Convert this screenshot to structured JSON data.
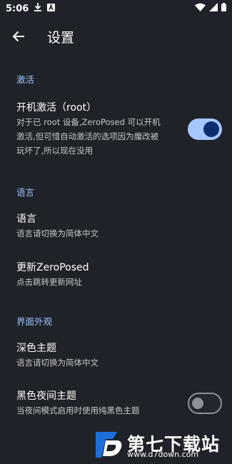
{
  "status_bar": {
    "time": "5:06",
    "icons": [
      "download-icon",
      "notification-a-icon",
      "wifi-icon",
      "signal-icon",
      "battery-icon"
    ]
  },
  "app_bar": {
    "title": "设置",
    "back_icon": "arrow-back-icon"
  },
  "sections": {
    "activation": {
      "header": "激活",
      "items": [
        {
          "title": "开机激活（root）",
          "subtitle_lines": [
            "对于已 root 设备,ZeroPosed 可以开机",
            "激活,但可惜自动激活的选项因为魔改被",
            "玩坏了,所以现在没用"
          ],
          "switch_on": true
        }
      ]
    },
    "language": {
      "header": "语言",
      "items": [
        {
          "title": "语言",
          "subtitle": "语言请切换为简体中文"
        },
        {
          "title": "更新ZeroPosed",
          "subtitle": "点击跳转更新网址"
        }
      ]
    },
    "appearance": {
      "header": "界面外观",
      "items": [
        {
          "title": "深色主题",
          "subtitle": "语言请切换为简体中文"
        },
        {
          "title": "黑色夜间主题",
          "subtitle": "当夜间模式启用时使用纯黑色主题",
          "switch_on": false
        }
      ]
    }
  },
  "watermark": {
    "name": "第七下载站",
    "url": "www.d7down.com"
  },
  "colors": {
    "background": "#1f2228",
    "accent": "#a6c8ff",
    "section_header": "#9ec3ff",
    "subtitle": "#c5c7cc"
  }
}
